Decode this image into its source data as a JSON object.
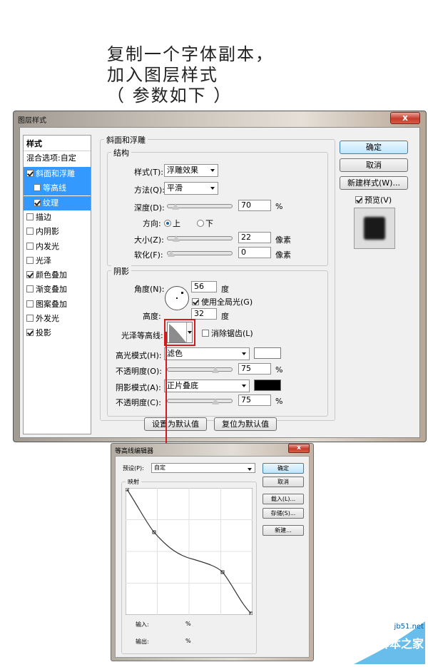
{
  "caption": {
    "line1": "复制一个字体副本，",
    "line2": "加入图层样式",
    "line3": "（ 参数如下 ）"
  },
  "layer_style_window": {
    "title": "图层样式",
    "close_glyph": "x",
    "style_list": {
      "header": "样式",
      "blend_options": "混合选项:自定",
      "items": [
        {
          "label": "斜面和浮雕",
          "checked": true,
          "selected": true,
          "sub": false
        },
        {
          "label": "等高线",
          "checked": false,
          "selected": true,
          "sub": true
        },
        {
          "label": "纹理",
          "checked": true,
          "selected": true,
          "sub": true
        },
        {
          "label": "描边",
          "checked": false,
          "selected": false,
          "sub": false
        },
        {
          "label": "内阴影",
          "checked": false,
          "selected": false,
          "sub": false
        },
        {
          "label": "内发光",
          "checked": false,
          "selected": false,
          "sub": false
        },
        {
          "label": "光泽",
          "checked": false,
          "selected": false,
          "sub": false
        },
        {
          "label": "颜色叠加",
          "checked": true,
          "selected": false,
          "sub": false
        },
        {
          "label": "渐变叠加",
          "checked": false,
          "selected": false,
          "sub": false
        },
        {
          "label": "图案叠加",
          "checked": false,
          "selected": false,
          "sub": false
        },
        {
          "label": "外发光",
          "checked": false,
          "selected": false,
          "sub": false
        },
        {
          "label": "投影",
          "checked": true,
          "selected": false,
          "sub": false
        }
      ]
    },
    "bevel": {
      "title": "斜面和浮雕",
      "structure_title": "结构",
      "style_label": "样式(T):",
      "style_value": "浮雕效果",
      "technique_label": "方法(Q):",
      "technique_value": "平滑",
      "depth_label": "深度(D):",
      "depth_value": "70",
      "depth_unit": "%",
      "depth_level": 0.07,
      "direction_label": "方向:",
      "direction_up": "上",
      "direction_down": "下",
      "size_label": "大小(Z):",
      "size_value": "22",
      "size_unit": "像素",
      "size_level": 0.09,
      "soften_label": "软化(F):",
      "soften_value": "0",
      "soften_unit": "像素",
      "soften_level": 0.0
    },
    "shading": {
      "title": "阴影",
      "angle_label": "角度(N):",
      "angle_value": "56",
      "angle_unit": "度",
      "global_light": "使用全局光(G)",
      "altitude_label": "高度:",
      "altitude_value": "32",
      "altitude_unit": "度",
      "gloss_label": "光泽等高线:",
      "anti_alias": "消除锯齿(L)",
      "highlight_label": "高光模式(H):",
      "highlight_value": "滤色",
      "highlight_color": "#ffffff",
      "opacity1_label": "不透明度(O):",
      "opacity1_value": "75",
      "opacity1_unit": "%",
      "opacity1_level": 0.75,
      "shadow_label": "阴影模式(A):",
      "shadow_value": "正片叠底",
      "shadow_color": "#000000",
      "opacity2_label": "不透明度(C):",
      "opacity2_value": "75",
      "opacity2_unit": "%",
      "opacity2_level": 0.75
    },
    "default_buttons": {
      "make_default": "设置为默认值",
      "reset_default": "复位为默认值"
    },
    "right_buttons": {
      "ok": "确定",
      "cancel": "取消",
      "new_style": "新建样式(W)...",
      "preview": "预览(V)"
    }
  },
  "contour_editor": {
    "title": "等高线编辑器",
    "preset_label": "预设(P):",
    "preset_value": "自定",
    "mapping_title": "映射",
    "ok": "确定",
    "cancel": "取消",
    "load": "载入(L)...",
    "save": "存储(S)...",
    "new": "新建...",
    "input_label": "输入:",
    "input_unit": "%",
    "output_label": "输出:",
    "output_unit": "%"
  },
  "watermark": {
    "site": "jb51.net",
    "name": "脚本之家"
  },
  "colors": {
    "selection": "#3399ff",
    "highlight_box": "#d7191c"
  }
}
